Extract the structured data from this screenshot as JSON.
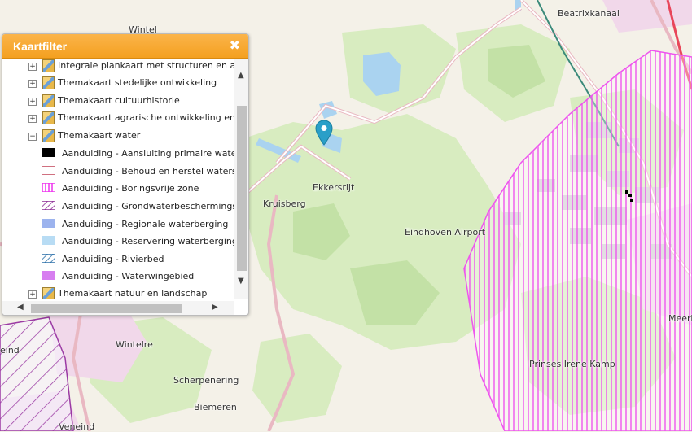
{
  "map": {
    "place_labels": [
      {
        "id": "beatrixkanaal",
        "text": "Beatrixkanaal"
      },
      {
        "id": "ekkersrijt",
        "text": "Ekkersrijt"
      },
      {
        "id": "kruisberg",
        "text": "Kruisberg"
      },
      {
        "id": "eindhoven-airport",
        "text": "Eindhoven Airport"
      },
      {
        "id": "wintelre",
        "text": "Wintelre"
      },
      {
        "id": "scherpenering",
        "text": "Scherpenering"
      },
      {
        "id": "biemeren",
        "text": "Biemeren"
      },
      {
        "id": "prinses-irene-kamp",
        "text": "Prinses Irene Kamp"
      },
      {
        "id": "meerh",
        "text": "Meerh"
      },
      {
        "id": "veneind-top",
        "text": "eind"
      },
      {
        "id": "veneind-bottom",
        "text": "Veneind"
      },
      {
        "id": "wintelre-top",
        "text": "Wintel"
      }
    ]
  },
  "panel": {
    "title": "Kaartfilter",
    "close_glyph": "✖",
    "items": [
      {
        "type": "theme",
        "toggle": "+",
        "label": "Integrale plankaart met structuren en aanduidingen"
      },
      {
        "type": "theme",
        "toggle": "+",
        "label": "Themakaart stedelijke ontwikkeling"
      },
      {
        "type": "theme",
        "toggle": "+",
        "label": "Themakaart cultuurhistorie"
      },
      {
        "type": "theme",
        "toggle": "+",
        "label": "Themakaart agrarische ontwikkeling en windenergie"
      },
      {
        "type": "theme",
        "toggle": "−",
        "label": "Themakaart water"
      },
      {
        "type": "legend",
        "swatch": "black",
        "label": "Aanduiding - Aansluiting primaire waterkering"
      },
      {
        "type": "legend",
        "swatch": "outline-pink",
        "label": "Aanduiding - Behoud en herstel watersystemen"
      },
      {
        "type": "legend",
        "swatch": "vstripes-magenta",
        "label": "Aanduiding - Boringsvrije zone"
      },
      {
        "type": "legend",
        "swatch": "diag-purple",
        "label": "Aanduiding - Grondwaterbeschermingsgebied"
      },
      {
        "type": "legend",
        "swatch": "fill-blue",
        "label": "Aanduiding - Regionale waterberging"
      },
      {
        "type": "legend",
        "swatch": "fill-lightblue",
        "label": "Aanduiding - Reservering waterberging"
      },
      {
        "type": "legend",
        "swatch": "diag-blue",
        "label": "Aanduiding - Rivierbed"
      },
      {
        "type": "legend",
        "swatch": "fill-violet",
        "label": "Aanduiding - Waterwingebied"
      },
      {
        "type": "theme",
        "toggle": "+",
        "label": "Themakaart natuur en landschap"
      }
    ]
  },
  "colors": {
    "header_orange": "#f6a623",
    "zone_magenta": "#ee66ee",
    "water_blue": "#aad3f0",
    "forest_green": "#d8ecc0"
  }
}
